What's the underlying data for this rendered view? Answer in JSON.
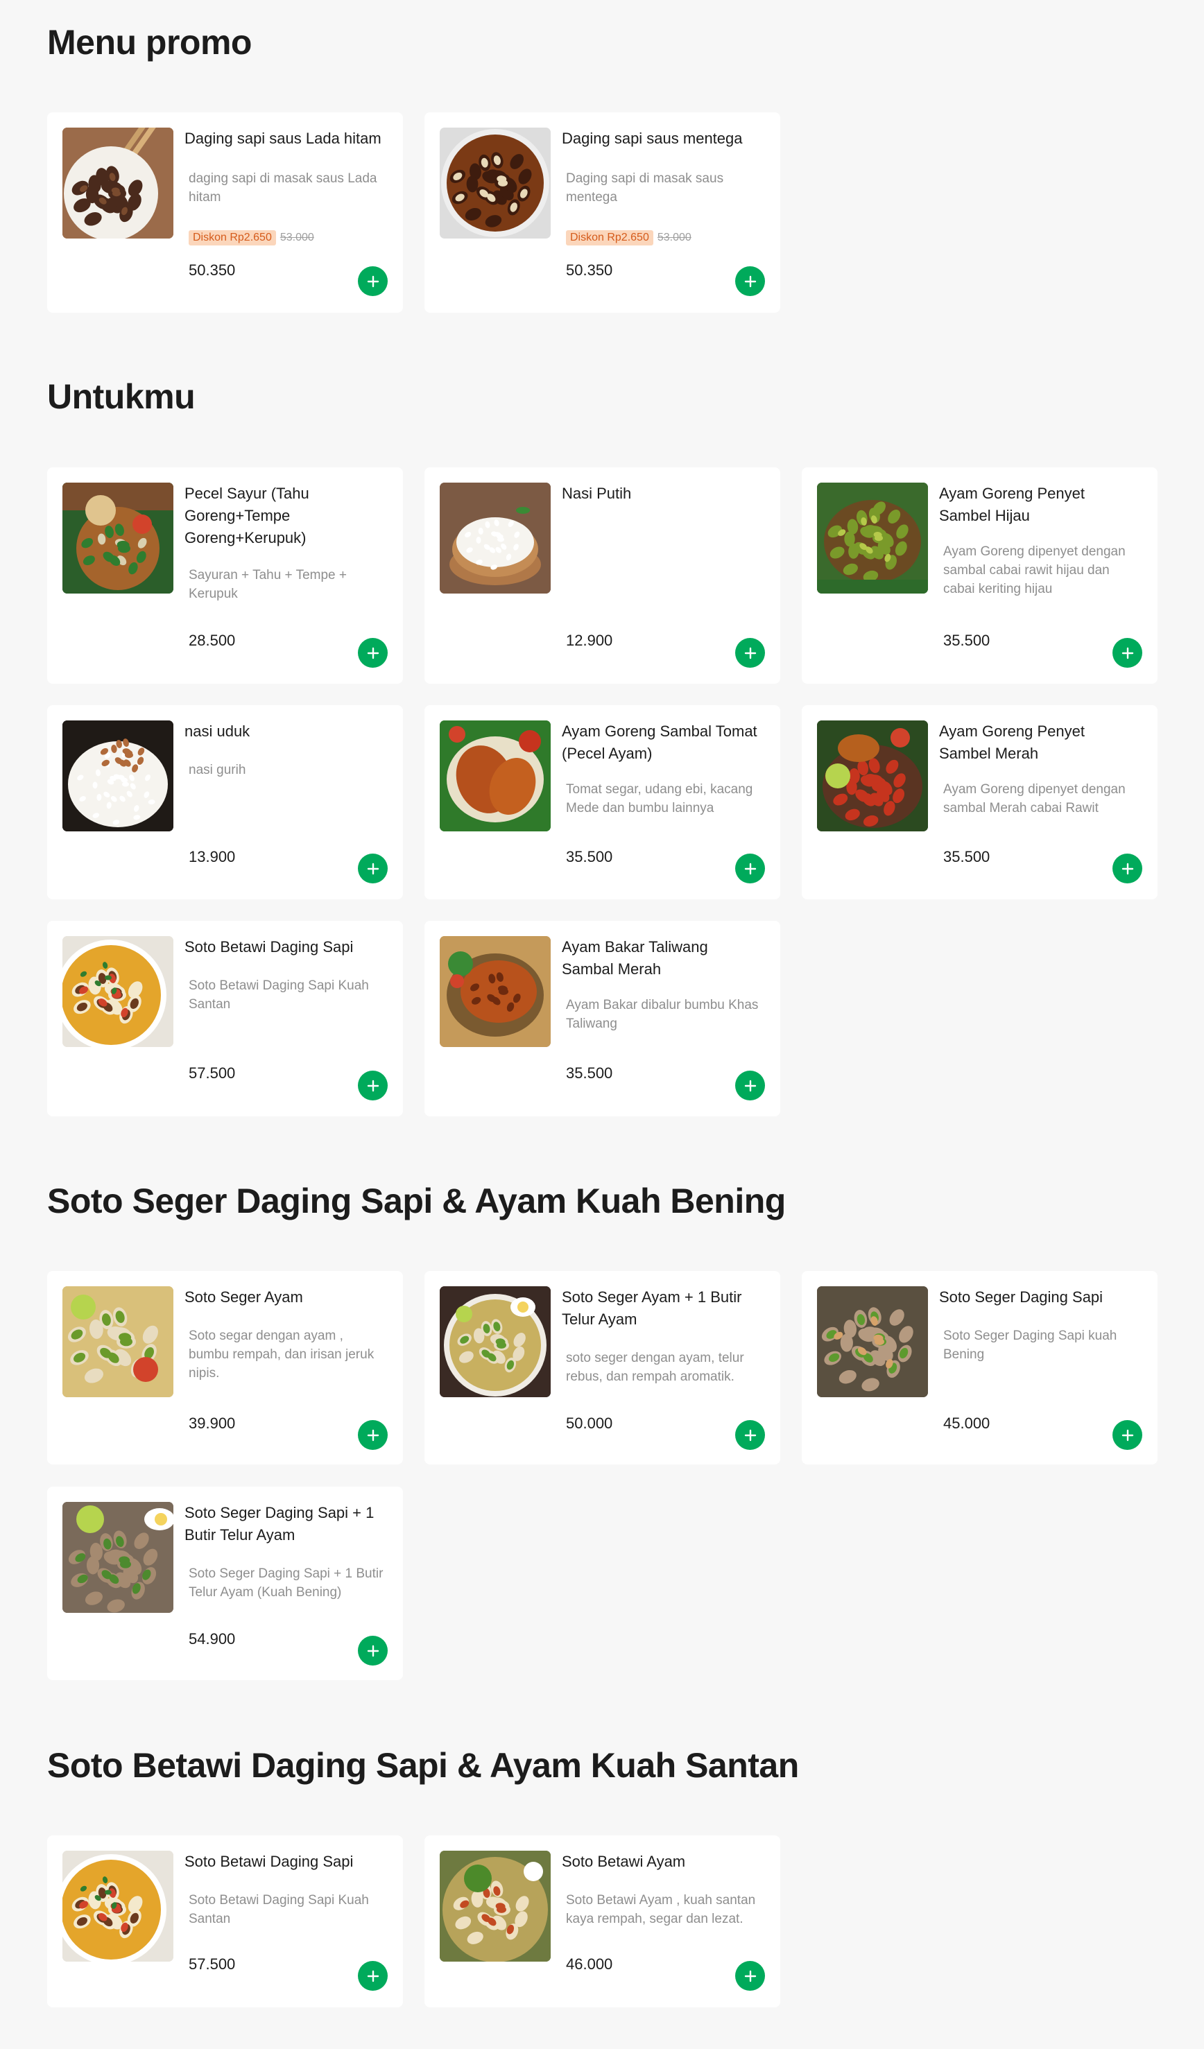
{
  "colors": {
    "page_bg": "#f7f7f7",
    "card_bg": "#ffffff",
    "add_button": "#00aa5b",
    "promo_badge_bg": "#fbd6bb",
    "promo_badge_text": "#d55b1b"
  },
  "sections": [
    {
      "title": "Menu promo",
      "items": [
        {
          "name": "Daging sapi saus Lada hitam",
          "description": "daging sapi di masak saus Lada hitam",
          "promo": "Diskon Rp2.650",
          "original_price": "53.000",
          "price": "50.350",
          "image": "beef-black-pepper"
        },
        {
          "name": "Daging sapi saus mentega",
          "description": "Daging sapi di masak saus mentega",
          "promo": "Diskon Rp2.650",
          "original_price": "53.000",
          "price": "50.350",
          "image": "beef-butter"
        }
      ]
    },
    {
      "title": "Untukmu",
      "items": [
        {
          "name": "Pecel Sayur (Tahu Goreng+Tempe Goreng+Kerupuk)",
          "description": "Sayuran + Tahu + Tempe + Kerupuk",
          "price": "28.500",
          "image": "pecel-sayur"
        },
        {
          "name": "Nasi Putih",
          "description": "",
          "price": "12.900",
          "image": "white-rice"
        },
        {
          "name": "Ayam Goreng Penyet Sambel Hijau",
          "description": "Ayam Goreng dipenyet dengan sambal cabai rawit hijau dan cabai keriting hijau",
          "price": "35.500",
          "image": "green-chili-chicken"
        },
        {
          "name": "nasi uduk",
          "description": "nasi gurih",
          "price": "13.900",
          "image": "nasi-uduk"
        },
        {
          "name": "Ayam Goreng Sambal Tomat (Pecel Ayam)",
          "description": "Tomat segar, udang ebi, kacang Mede dan bumbu lainnya",
          "price": "35.500",
          "image": "fried-chicken"
        },
        {
          "name": "Ayam Goreng Penyet Sambel Merah",
          "description": "Ayam Goreng dipenyet dengan sambal Merah cabai Rawit",
          "price": "35.500",
          "image": "red-chili-chicken"
        },
        {
          "name": "Soto Betawi Daging Sapi",
          "description": "Soto Betawi Daging Sapi Kuah Santan",
          "price": "57.500",
          "image": "soto-betawi"
        },
        {
          "name": "Ayam Bakar Taliwang Sambal Merah",
          "description": "Ayam Bakar dibalur bumbu Khas Taliwang",
          "price": "35.500",
          "image": "grilled-chicken"
        }
      ]
    },
    {
      "title": "Soto Seger Daging Sapi & Ayam Kuah Bening",
      "items": [
        {
          "name": "Soto Seger Ayam",
          "description": "Soto segar dengan ayam , bumbu rempah, dan irisan jeruk nipis.",
          "price": "39.900",
          "image": "soto-seger-ayam"
        },
        {
          "name": "Soto Seger Ayam + 1 Butir Telur Ayam",
          "description": "soto seger dengan ayam, telur rebus, dan rempah aromatik.",
          "price": "50.000",
          "image": "soto-seger-egg"
        },
        {
          "name": "Soto Seger Daging Sapi",
          "description": "Soto Seger Daging Sapi kuah Bening",
          "price": "45.000",
          "image": "soto-seger-beef"
        },
        {
          "name": "Soto Seger Daging Sapi + 1 Butir Telur Ayam",
          "description": "Soto Seger Daging Sapi + 1 Butir Telur Ayam (Kuah Bening)",
          "price": "54.900",
          "image": "soto-seger-beef-egg"
        }
      ]
    },
    {
      "title": "Soto Betawi Daging Sapi & Ayam Kuah Santan",
      "items": [
        {
          "name": "Soto Betawi Daging Sapi",
          "description": "Soto Betawi Daging Sapi Kuah Santan",
          "price": "57.500",
          "image": "soto-betawi"
        },
        {
          "name": "Soto Betawi Ayam",
          "description": "Soto Betawi Ayam , kuah santan kaya rempah, segar dan lezat.",
          "price": "46.000",
          "image": "soto-betawi-ayam"
        }
      ]
    }
  ]
}
